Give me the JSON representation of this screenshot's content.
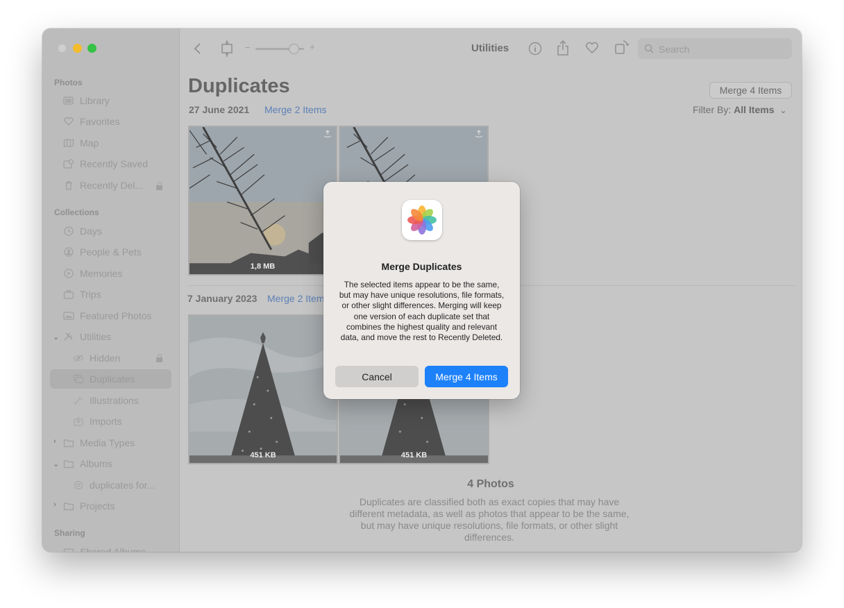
{
  "window": {
    "toolbar_title": "Utilities",
    "search_placeholder": "Search"
  },
  "sidebar": {
    "photos_header": "Photos",
    "photos_items": [
      {
        "label": "Library",
        "icon": "library-icon"
      },
      {
        "label": "Favorites",
        "icon": "heart-icon"
      },
      {
        "label": "Map",
        "icon": "map-icon"
      },
      {
        "label": "Recently Saved",
        "icon": "recently-saved-icon"
      },
      {
        "label": "Recently Del...",
        "icon": "trash-icon",
        "locked": true
      }
    ],
    "collections_header": "Collections",
    "collections_items": [
      {
        "label": "Days",
        "icon": "clock-icon"
      },
      {
        "label": "People & Pets",
        "icon": "person-icon"
      },
      {
        "label": "Memories",
        "icon": "memories-icon"
      },
      {
        "label": "Trips",
        "icon": "suitcase-icon"
      },
      {
        "label": "Featured Photos",
        "icon": "featured-icon"
      },
      {
        "label": "Utilities",
        "icon": "tools-icon",
        "expanded": true
      },
      {
        "label": "Hidden",
        "icon": "eye-icon",
        "locked": true
      },
      {
        "label": "Duplicates",
        "icon": "duplicates-icon",
        "selected": true
      },
      {
        "label": "Illustrations",
        "icon": "illustrations-icon"
      },
      {
        "label": "Imports",
        "icon": "import-icon"
      },
      {
        "label": "Media Types",
        "icon": "folder-icon",
        "expanded": false
      },
      {
        "label": "Albums",
        "icon": "folder-icon",
        "expanded": true
      },
      {
        "label": "duplicates for...",
        "icon": "gear-icon"
      },
      {
        "label": "Projects",
        "icon": "folder-icon",
        "expanded": false
      }
    ],
    "sharing_header": "Sharing",
    "sharing_items": [
      {
        "label": "Shared Albums",
        "icon": "shared-albums-icon"
      }
    ]
  },
  "main": {
    "title": "Duplicates",
    "merge_all_label": "Merge 4 Items",
    "filter_prefix": "Filter By:",
    "filter_value": "All Items",
    "groups": [
      {
        "date": "27 June 2021",
        "merge_label": "Merge 2 Items",
        "photos": [
          {
            "size": "1,8 MB"
          },
          {
            "size": ""
          }
        ]
      },
      {
        "date": "7 January 2023",
        "merge_label": "Merge 2 Items",
        "photos": [
          {
            "size": "451 KB"
          },
          {
            "size": "451 KB"
          }
        ]
      }
    ],
    "summary_title": "4 Photos",
    "summary_text": "Duplicates are classified both as exact copies that may have different metadata, as well as photos that appear to be the same, but may have unique resolutions, file formats, or other slight differences."
  },
  "dialog": {
    "title": "Merge Duplicates",
    "message": "The selected items appear to be the same, but may have unique resolutions, file formats, or other slight differences. Merging will keep one version of each duplicate set that combines the highest quality and relevant data, and move the rest to Recently Deleted.",
    "cancel_label": "Cancel",
    "confirm_label": "Merge 4 Items",
    "accent_color": "#1d81f9"
  }
}
